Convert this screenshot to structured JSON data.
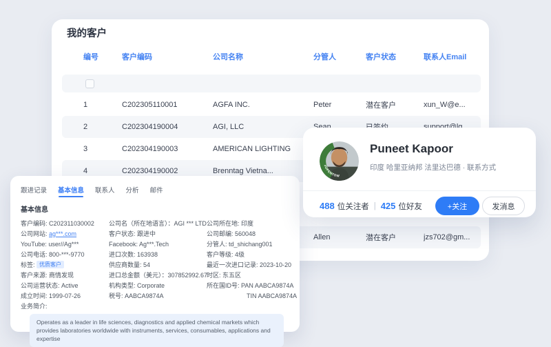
{
  "customers_table": {
    "title": "我的客户",
    "columns": [
      "编号",
      "客户编码",
      "公司名称",
      "分管人",
      "客户状态",
      "联系人Email"
    ],
    "rows": [
      {
        "no": "1",
        "code": "C202305110001",
        "company": "AGFA INC.",
        "manager": "Peter",
        "status": "潜在客户",
        "email": "xun_W@e..."
      },
      {
        "no": "2",
        "code": "C202304190004",
        "company": "AGI, LLC",
        "manager": "Sean",
        "status": "已签约",
        "email": "support@lg..."
      },
      {
        "no": "3",
        "code": "C202304190003",
        "company": "AMERICAN LIGHTING",
        "manager": "",
        "status": "",
        "email": ""
      },
      {
        "no": "4",
        "code": "C202304190002",
        "company": "Brenntag Vietna...",
        "manager": "",
        "status": "",
        "email": ""
      },
      {
        "no": "",
        "code": "",
        "company": "",
        "manager": "",
        "status": "",
        "email": ""
      },
      {
        "no": "",
        "code": "",
        "company": "",
        "manager": "",
        "status": "",
        "email": ""
      },
      {
        "no": "",
        "code": "",
        "company": "",
        "manager": "Allen",
        "status": "潜在客户",
        "email": "jzs702@gm..."
      }
    ]
  },
  "profile_card": {
    "name": "Puneet Kapoor",
    "location_line": "印度 哈里亚纳邦 法里达巴德 · 联系方式",
    "followers_count": "488",
    "followers_label": "位关注者",
    "separator": "|",
    "friends_count": "425",
    "friends_label": "位好友",
    "follow_button": "+关注",
    "message_button": "发消息",
    "avatar_banner": "#OPENTOWORK",
    "accent_color": "#2e7cf6",
    "banner_color": "#3e7c3a"
  },
  "detail_panel": {
    "tabs": [
      "跟进记录",
      "基本信息",
      "联系人",
      "分析",
      "邮件"
    ],
    "section_title": "基本信息",
    "col1": {
      "customer_code": "客户编码: C202311030002",
      "website_label": "公司网站: ",
      "website_link": "ag***.com",
      "youtube": "YouTube: user//Ag***",
      "phone": "公司电话: 800-***-9770",
      "tag_label": "标签: ",
      "tag_value": "优质客户",
      "source": "客户来源: 商情发现",
      "operating_status": "公司运营状态: Active",
      "founded": "成立时间: 1999-07-26",
      "business_intro_label": "业务简介:"
    },
    "col2": {
      "company_local_name": "公司名（所在地语言）：AGI *** LTD",
      "customer_status": "客户状态: 跟进中",
      "facebook": "Facebook: Ag***.Tech",
      "import_count": "进口次数: 163938",
      "supplier_count": "供应商数量: 54",
      "import_total": "进口总金额（美元）：307852992.67",
      "org_type": "机构类型: Corporate",
      "tax_id": "税号: AABCA9874A"
    },
    "col3": {
      "location": "公司所在地: 印度",
      "postcode": "公司邮编: 560048",
      "manager": "分管人: td_shichang001",
      "level": "客户等级: 4级",
      "last_import": "最近一次进口记录: 2023-10-20",
      "timezone": "时区: 东五区",
      "country_id": "所在国ID号: PAN AABCA9874A",
      "tin": "TIN AABCA9874A"
    },
    "description": "Operates as a leader in life sciences, diagnostics and applied chemical markets which provides laboratories worldwide with instruments, services, consumables, applications and expertise"
  }
}
